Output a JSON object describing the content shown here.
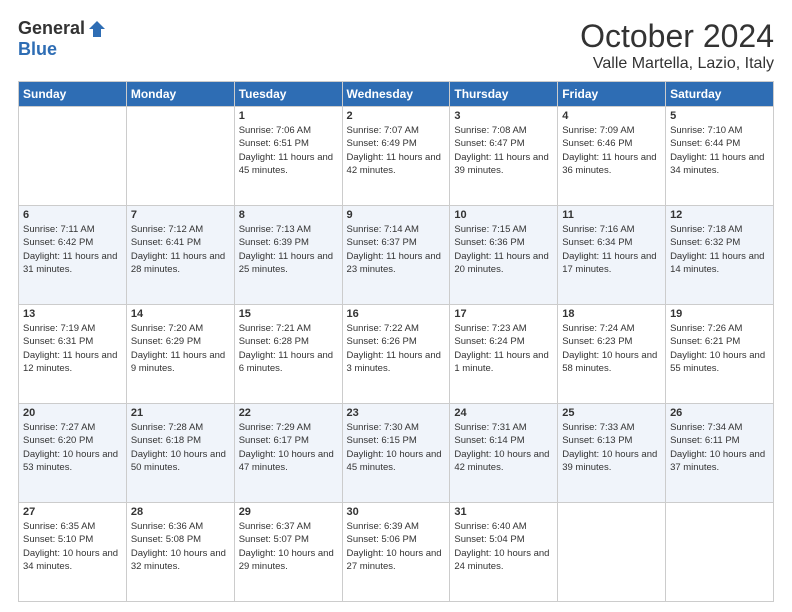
{
  "logo": {
    "general": "General",
    "blue": "Blue"
  },
  "title": "October 2024",
  "location": "Valle Martella, Lazio, Italy",
  "days_header": [
    "Sunday",
    "Monday",
    "Tuesday",
    "Wednesday",
    "Thursday",
    "Friday",
    "Saturday"
  ],
  "weeks": [
    [
      {
        "day": "",
        "info": ""
      },
      {
        "day": "",
        "info": ""
      },
      {
        "day": "1",
        "info": "Sunrise: 7:06 AM\nSunset: 6:51 PM\nDaylight: 11 hours and 45 minutes."
      },
      {
        "day": "2",
        "info": "Sunrise: 7:07 AM\nSunset: 6:49 PM\nDaylight: 11 hours and 42 minutes."
      },
      {
        "day": "3",
        "info": "Sunrise: 7:08 AM\nSunset: 6:47 PM\nDaylight: 11 hours and 39 minutes."
      },
      {
        "day": "4",
        "info": "Sunrise: 7:09 AM\nSunset: 6:46 PM\nDaylight: 11 hours and 36 minutes."
      },
      {
        "day": "5",
        "info": "Sunrise: 7:10 AM\nSunset: 6:44 PM\nDaylight: 11 hours and 34 minutes."
      }
    ],
    [
      {
        "day": "6",
        "info": "Sunrise: 7:11 AM\nSunset: 6:42 PM\nDaylight: 11 hours and 31 minutes."
      },
      {
        "day": "7",
        "info": "Sunrise: 7:12 AM\nSunset: 6:41 PM\nDaylight: 11 hours and 28 minutes."
      },
      {
        "day": "8",
        "info": "Sunrise: 7:13 AM\nSunset: 6:39 PM\nDaylight: 11 hours and 25 minutes."
      },
      {
        "day": "9",
        "info": "Sunrise: 7:14 AM\nSunset: 6:37 PM\nDaylight: 11 hours and 23 minutes."
      },
      {
        "day": "10",
        "info": "Sunrise: 7:15 AM\nSunset: 6:36 PM\nDaylight: 11 hours and 20 minutes."
      },
      {
        "day": "11",
        "info": "Sunrise: 7:16 AM\nSunset: 6:34 PM\nDaylight: 11 hours and 17 minutes."
      },
      {
        "day": "12",
        "info": "Sunrise: 7:18 AM\nSunset: 6:32 PM\nDaylight: 11 hours and 14 minutes."
      }
    ],
    [
      {
        "day": "13",
        "info": "Sunrise: 7:19 AM\nSunset: 6:31 PM\nDaylight: 11 hours and 12 minutes."
      },
      {
        "day": "14",
        "info": "Sunrise: 7:20 AM\nSunset: 6:29 PM\nDaylight: 11 hours and 9 minutes."
      },
      {
        "day": "15",
        "info": "Sunrise: 7:21 AM\nSunset: 6:28 PM\nDaylight: 11 hours and 6 minutes."
      },
      {
        "day": "16",
        "info": "Sunrise: 7:22 AM\nSunset: 6:26 PM\nDaylight: 11 hours and 3 minutes."
      },
      {
        "day": "17",
        "info": "Sunrise: 7:23 AM\nSunset: 6:24 PM\nDaylight: 11 hours and 1 minute."
      },
      {
        "day": "18",
        "info": "Sunrise: 7:24 AM\nSunset: 6:23 PM\nDaylight: 10 hours and 58 minutes."
      },
      {
        "day": "19",
        "info": "Sunrise: 7:26 AM\nSunset: 6:21 PM\nDaylight: 10 hours and 55 minutes."
      }
    ],
    [
      {
        "day": "20",
        "info": "Sunrise: 7:27 AM\nSunset: 6:20 PM\nDaylight: 10 hours and 53 minutes."
      },
      {
        "day": "21",
        "info": "Sunrise: 7:28 AM\nSunset: 6:18 PM\nDaylight: 10 hours and 50 minutes."
      },
      {
        "day": "22",
        "info": "Sunrise: 7:29 AM\nSunset: 6:17 PM\nDaylight: 10 hours and 47 minutes."
      },
      {
        "day": "23",
        "info": "Sunrise: 7:30 AM\nSunset: 6:15 PM\nDaylight: 10 hours and 45 minutes."
      },
      {
        "day": "24",
        "info": "Sunrise: 7:31 AM\nSunset: 6:14 PM\nDaylight: 10 hours and 42 minutes."
      },
      {
        "day": "25",
        "info": "Sunrise: 7:33 AM\nSunset: 6:13 PM\nDaylight: 10 hours and 39 minutes."
      },
      {
        "day": "26",
        "info": "Sunrise: 7:34 AM\nSunset: 6:11 PM\nDaylight: 10 hours and 37 minutes."
      }
    ],
    [
      {
        "day": "27",
        "info": "Sunrise: 6:35 AM\nSunset: 5:10 PM\nDaylight: 10 hours and 34 minutes."
      },
      {
        "day": "28",
        "info": "Sunrise: 6:36 AM\nSunset: 5:08 PM\nDaylight: 10 hours and 32 minutes."
      },
      {
        "day": "29",
        "info": "Sunrise: 6:37 AM\nSunset: 5:07 PM\nDaylight: 10 hours and 29 minutes."
      },
      {
        "day": "30",
        "info": "Sunrise: 6:39 AM\nSunset: 5:06 PM\nDaylight: 10 hours and 27 minutes."
      },
      {
        "day": "31",
        "info": "Sunrise: 6:40 AM\nSunset: 5:04 PM\nDaylight: 10 hours and 24 minutes."
      },
      {
        "day": "",
        "info": ""
      },
      {
        "day": "",
        "info": ""
      }
    ]
  ]
}
